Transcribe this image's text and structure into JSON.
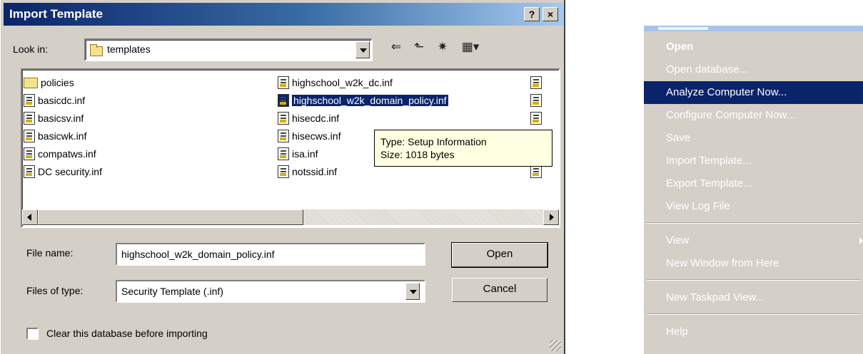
{
  "dialog": {
    "title": "Import Template",
    "help_button": "?",
    "close_button": "×",
    "look_in_label": "Look in:",
    "look_in_value": "templates",
    "files": [
      "policies",
      "basicdc.inf",
      "basicsv.inf",
      "basicwk.inf",
      "compatws.inf",
      "DC security.inf",
      "highschool_w2k_dc.inf",
      "highschool_w2k_domain_policy.inf",
      "hisecdc.inf",
      "hisecws.inf",
      "isa.inf",
      "notssid.inf"
    ],
    "tooltip": {
      "type": "Type: Setup Information",
      "size": "Size: 1018 bytes"
    },
    "file_name_label": "File name:",
    "file_name_value": "highschool_w2k_domain_policy.inf",
    "files_of_type_label": "Files of type:",
    "files_of_type_value": "Security Template (.inf)",
    "open_button": "Open",
    "cancel_button": "Cancel",
    "clear_db_label": "Clear this database before importing"
  },
  "context_menu": {
    "items": [
      "Open",
      "Open database...",
      "Analyze Computer Now...",
      "Configure Computer Now...",
      "Save",
      "Import Template...",
      "Export Template...",
      "View Log File",
      "View",
      "New Window from Here",
      "New Taskpad View...",
      "Help"
    ]
  }
}
